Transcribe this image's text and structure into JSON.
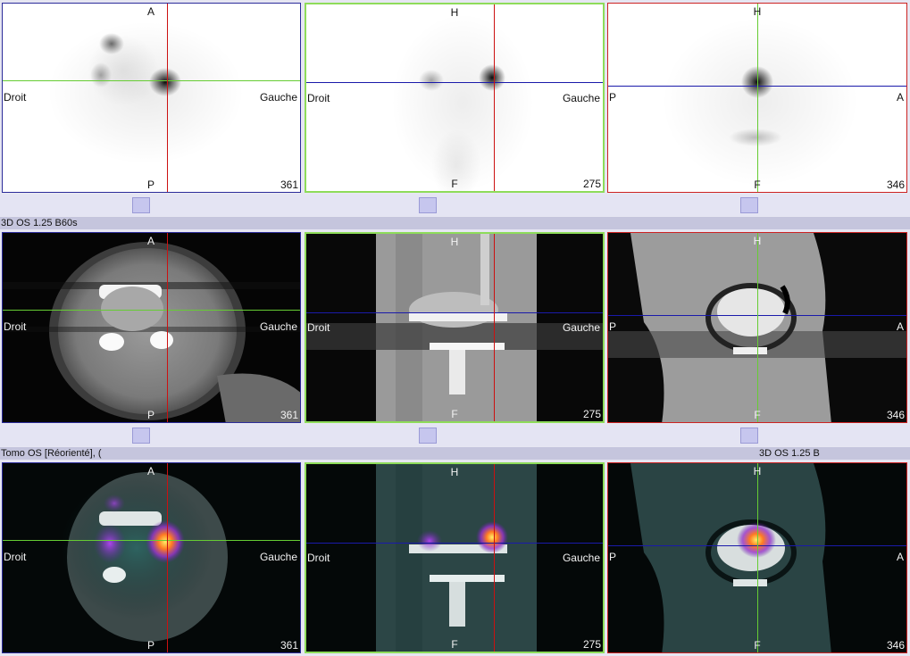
{
  "rows": [
    {
      "key": "spect",
      "theme": "spect",
      "views": [
        {
          "plane": "axial",
          "top": "A",
          "bottom": "P",
          "left": "Droit",
          "right": "Gauche",
          "slice": "361",
          "frame_color": "#2b2b9a"
        },
        {
          "plane": "coronal",
          "top": "H",
          "bottom": "F",
          "left": "Droit",
          "right": "Gauche",
          "slice": "275",
          "frame_color": "#8edc5a"
        },
        {
          "plane": "sagittal",
          "top": "H",
          "bottom": "F",
          "left": "P",
          "right": "A",
          "slice": "346",
          "frame_color": "#cc2222"
        }
      ]
    },
    {
      "key": "ct",
      "theme": "ct",
      "series_label": "3D OS  1.25  B60s",
      "views": [
        {
          "plane": "axial",
          "top": "A",
          "bottom": "P",
          "left": "Droit",
          "right": "Gauche",
          "slice": "361",
          "frame_color": "#2b2b9a"
        },
        {
          "plane": "coronal",
          "top": "H",
          "bottom": "F",
          "left": "Droit",
          "right": "Gauche",
          "slice": "275",
          "frame_color": "#8edc5a"
        },
        {
          "plane": "sagittal",
          "top": "H",
          "bottom": "F",
          "left": "P",
          "right": "A",
          "slice": "346",
          "frame_color": "#cc2222"
        }
      ]
    },
    {
      "key": "fusion",
      "theme": "fusion",
      "series_label": "Tomo OS [Réorienté], (",
      "series_label_right": "3D OS  1.25  B",
      "views": [
        {
          "plane": "axial",
          "top": "A",
          "bottom": "P",
          "left": "Droit",
          "right": "Gauche",
          "slice": "361",
          "frame_color": "#2b2b9a"
        },
        {
          "plane": "coronal",
          "top": "H",
          "bottom": "F",
          "left": "Droit",
          "right": "Gauche",
          "slice": "275",
          "frame_color": "#8edc5a"
        },
        {
          "plane": "sagittal",
          "top": "H",
          "bottom": "F",
          "left": "P",
          "right": "A",
          "slice": "346",
          "frame_color": "#cc2222"
        }
      ]
    }
  ],
  "colors": {
    "crosshair_vertical_axial": "#cc1111",
    "crosshair_horizontal_axial": "#66cc33",
    "crosshair_horizontal_cor_sag": "#1a1aaa",
    "crosshair_vertical_coronal": "#cc1111",
    "crosshair_vertical_sagittal": "#66cc33"
  }
}
